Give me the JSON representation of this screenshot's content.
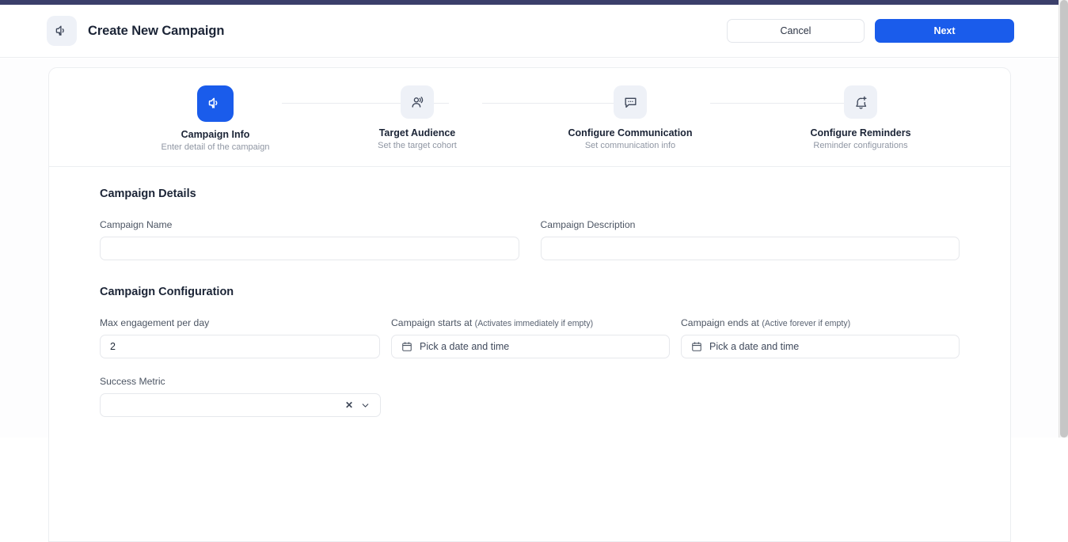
{
  "header": {
    "icon": "megaphone-icon",
    "title": "Create New Campaign",
    "cancel_label": "Cancel",
    "next_label": "Next"
  },
  "accent_color": "#1a5ceb",
  "topbar_color": "#3b3f6b",
  "stepper": {
    "steps": [
      {
        "icon": "megaphone-icon",
        "title": "Campaign Info",
        "subtitle": "Enter detail of the campaign",
        "active": true
      },
      {
        "icon": "audience-icon",
        "title": "Target Audience",
        "subtitle": "Set the target cohort",
        "active": false
      },
      {
        "icon": "chat-bubble-icon",
        "title": "Configure Communication",
        "subtitle": "Set communication info",
        "active": false
      },
      {
        "icon": "bell-plus-icon",
        "title": "Configure Reminders",
        "subtitle": "Reminder configurations",
        "active": false
      }
    ]
  },
  "form": {
    "details": {
      "section_title": "Campaign Details",
      "name_label": "Campaign Name",
      "name_value": "",
      "name_placeholder": "",
      "description_label": "Campaign Description",
      "description_value": "",
      "description_placeholder": ""
    },
    "configuration": {
      "section_title": "Campaign Configuration",
      "max_engagement_label": "Max engagement per day",
      "max_engagement_value": "2",
      "starts_at_label": "Campaign starts at ",
      "starts_at_hint": "(Activates immediately if empty)",
      "starts_at_placeholder": "Pick a date and time",
      "ends_at_label": "Campaign ends at ",
      "ends_at_hint": "(Active forever if empty)",
      "ends_at_placeholder": "Pick a date and time",
      "success_metric_label": "Success Metric",
      "success_metric_value": "",
      "success_metric_clear": "✕"
    }
  }
}
